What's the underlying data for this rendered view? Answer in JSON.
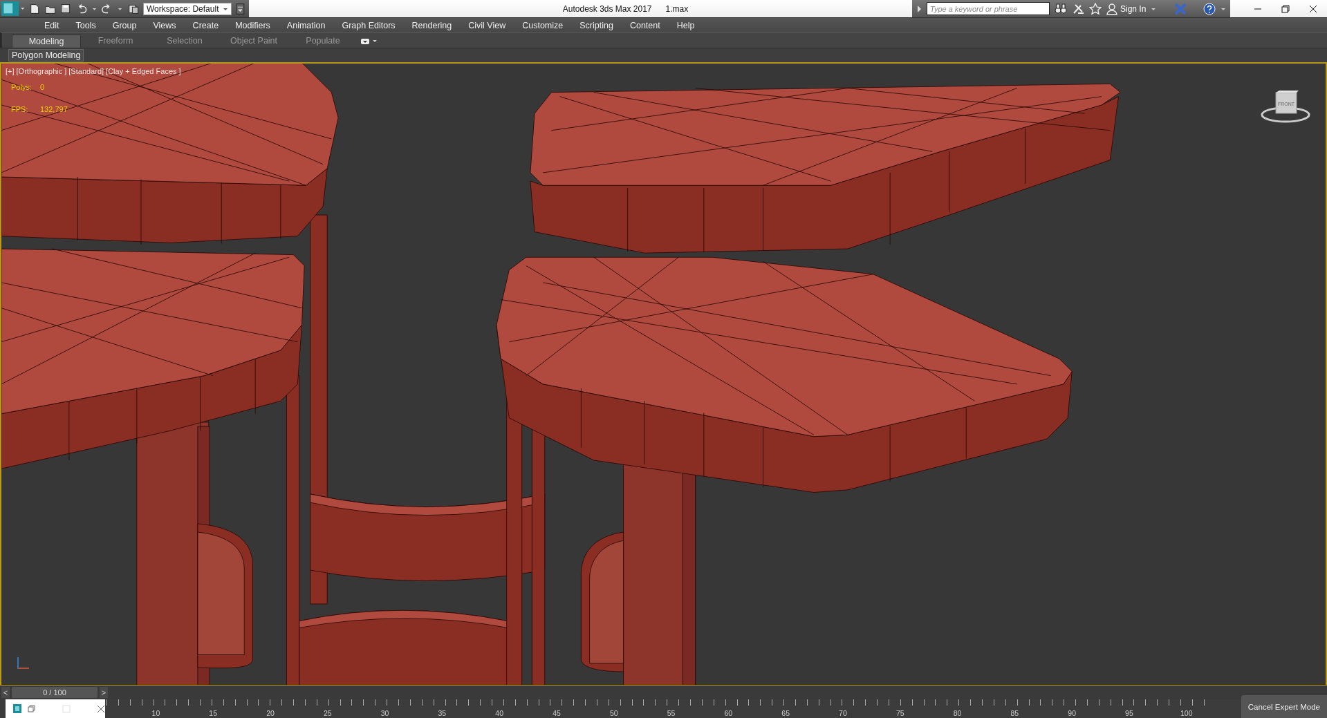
{
  "title_bar": {
    "workspace": "Workspace: Default",
    "app_title": "Autodesk 3ds Max 2017",
    "file_name": "1.max",
    "search": {
      "placeholder": "Type a keyword or phrase"
    },
    "sign_in": "Sign In"
  },
  "menu": [
    "Edit",
    "Tools",
    "Group",
    "Views",
    "Create",
    "Modifiers",
    "Animation",
    "Graph Editors",
    "Rendering",
    "Civil View",
    "Customize",
    "Scripting",
    "Content",
    "Help"
  ],
  "ribbon_tabs": [
    {
      "label": "Modeling",
      "selected": true
    },
    {
      "label": "Freeform",
      "selected": false
    },
    {
      "label": "Selection",
      "selected": false
    },
    {
      "label": "Object Paint",
      "selected": false
    },
    {
      "label": "Populate",
      "selected": false
    }
  ],
  "ribbon_panel": "Polygon Modeling",
  "viewport": {
    "labels": [
      "[+]",
      "[Orthographic ]",
      "[Standard]",
      "[Clay + Edged Faces ]"
    ],
    "stats": [
      {
        "label": "Polys:",
        "value": "0"
      },
      {
        "label": "FPS:",
        "value": "132,797"
      }
    ],
    "viewcube_label": "FRONT"
  },
  "time_slider": {
    "prev": "<",
    "frame": "0 / 100",
    "next": ">"
  },
  "track_ticks": [
    "10",
    "15",
    "20",
    "25",
    "30",
    "35",
    "40",
    "45",
    "50",
    "55",
    "60",
    "65",
    "70",
    "75",
    "80",
    "85",
    "90",
    "95",
    "100"
  ],
  "expert_button": "Cancel Expert Mode"
}
